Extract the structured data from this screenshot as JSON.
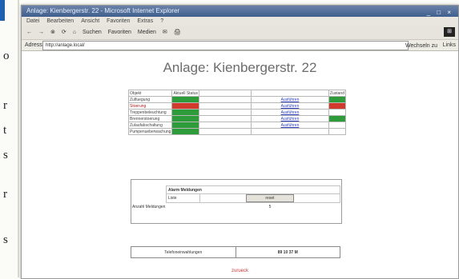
{
  "page": {
    "heading": "Anlage: Kienbergerstr. 22"
  },
  "browser": {
    "window_title": "Anlage: Kienbergerstr. 22 - Microsoft Internet Explorer",
    "window_controls": "_ □ ×",
    "menu": [
      "Datei",
      "Bearbeiten",
      "Ansicht",
      "Favoriten",
      "Extras",
      "?"
    ],
    "toolbar": [
      "←",
      "→",
      "⊗",
      "⟳",
      "⌂",
      "Suchen",
      "Favoriten",
      "Medien",
      "✉",
      "🖨"
    ],
    "address_label": "Adresse",
    "address_value": "http://anlage.local/",
    "go_label": "Wechseln zu",
    "links_label": "Links"
  },
  "status_table": {
    "headers": [
      "Objekt",
      "Aktuell Status",
      "",
      "Zustand"
    ],
    "link_text": "Ausführen",
    "rows": [
      {
        "name": "Zulfuegung",
        "status": "green",
        "link": true,
        "zustand": "green",
        "alarm": false
      },
      {
        "name": "Stoerung",
        "status": "red",
        "link": true,
        "zustand": "red",
        "alarm": true
      },
      {
        "name": "Treppenbeleuchtung",
        "status": "green",
        "link": true,
        "zustand": "",
        "alarm": false
      },
      {
        "name": "Brennerstoerung",
        "status": "green",
        "link": true,
        "zustand": "green",
        "alarm": false
      },
      {
        "name": "Zulaufabschaltung",
        "status": "green",
        "link": true,
        "zustand": "",
        "alarm": false
      },
      {
        "name": "Pumpenueberwachung",
        "status": "green",
        "link": false,
        "zustand": "",
        "alarm": false
      }
    ]
  },
  "alarm_box": {
    "title": "Alarm Meldungen",
    "reset_label": "Liste",
    "button_label": "reset",
    "count_label": "Anzahl Meldungen",
    "count_value": "5"
  },
  "counter": {
    "label": "Telefoneinwahlungen",
    "value": "89 10 37 M"
  },
  "footer": {
    "link": "zurueck"
  },
  "side_letters": [
    "o",
    "r",
    "t",
    "s",
    "r",
    "s"
  ],
  "colors": {
    "ok": "#2f9c3c",
    "alarm": "#d23a2e",
    "link": "#3040c0",
    "title": "#6c6c6c"
  }
}
